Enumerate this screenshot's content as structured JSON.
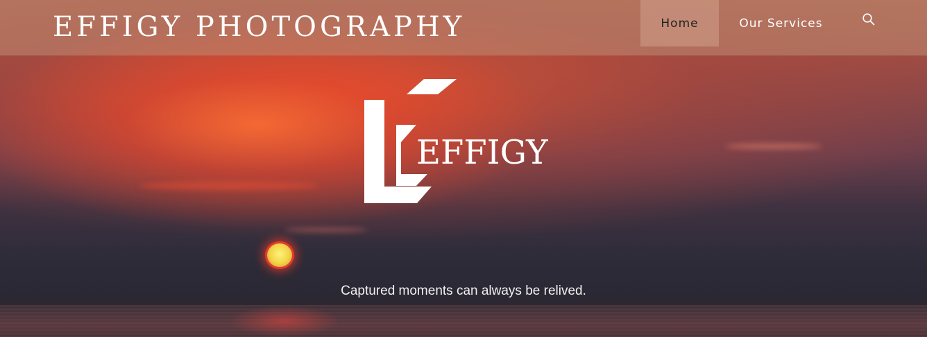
{
  "header": {
    "site_title": "EFFIGY PHOTOGRAPHY"
  },
  "nav": {
    "items": [
      {
        "label": "Home",
        "active": true
      },
      {
        "label": "Our Services",
        "active": false
      }
    ],
    "search_icon": "search-icon"
  },
  "hero": {
    "logo_text": "EFFIGY",
    "tagline": "Captured moments can always be relived."
  },
  "colors": {
    "nav_bar": "#be8c73",
    "text": "#ffffff",
    "sun": "#f3d64a",
    "sky_red": "#e8502e"
  }
}
